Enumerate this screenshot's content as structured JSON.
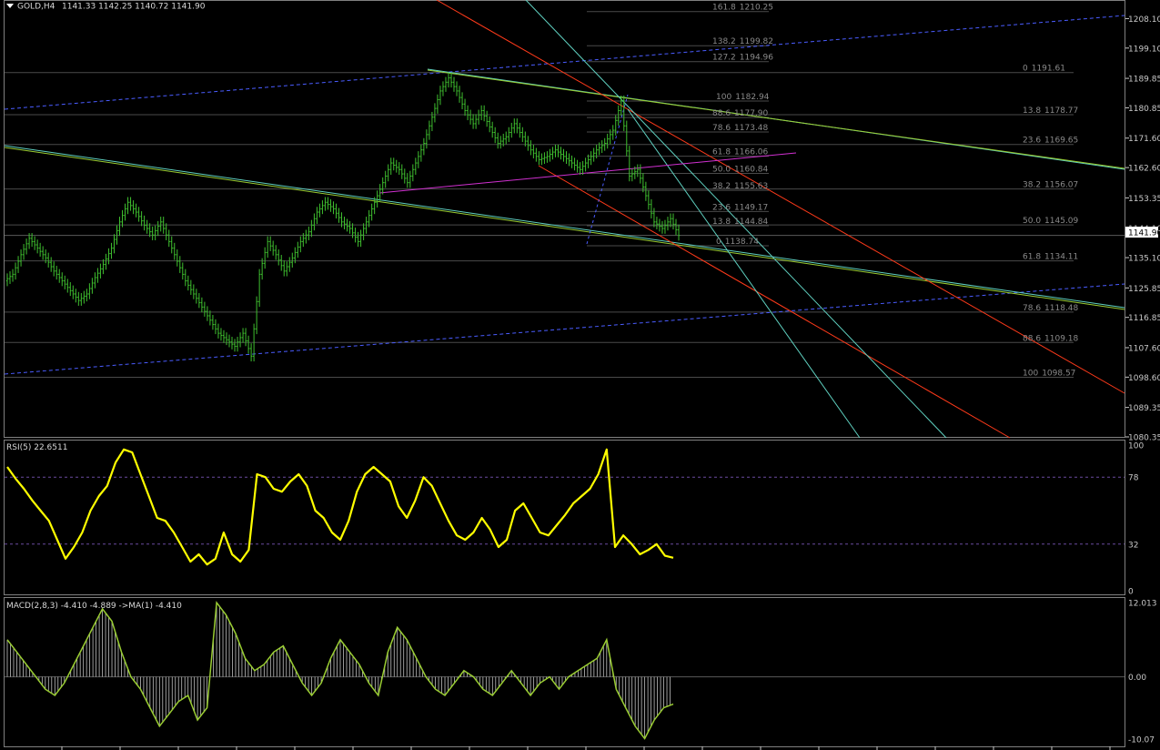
{
  "colors": {
    "background": "#000000",
    "candle": "#3fbf2f",
    "rsi_line": "#ffff00",
    "macd_line": "#9acd32",
    "macd_hist": "#c0c0c0",
    "grid": "#3a3a3a",
    "pane_border": "#808080",
    "price_tag_bg": "#ffffff",
    "fib_line": "#4a4a4a",
    "trend_green": "#9acd32",
    "trend_blue": "#4a5cff",
    "trend_red": "#ff3a1a",
    "trend_cyan": "#5fd0c0",
    "trend_magenta": "#d030d0",
    "rsi_levels": "#6a4aa0"
  },
  "header": {
    "symbol": "GOLD,H4",
    "ohlc": "1141.33 1142.25 1140.72 1141.90",
    "menu_icon": "triangle-down-icon"
  },
  "price_axis": {
    "ticks": [
      "1208.10",
      "1199.10",
      "1189.85",
      "1180.85",
      "1171.60",
      "1162.60",
      "1153.35",
      "1144.10",
      "1135.10",
      "1125.85",
      "1116.85",
      "1107.60",
      "1098.60",
      "1089.35",
      "1080.35"
    ],
    "current_price": "1141.90"
  },
  "fib_labels": {
    "set_a": [
      {
        "level": "161.8",
        "value": "1210.25"
      },
      {
        "level": "138.2",
        "value": "1199.82"
      },
      {
        "level": "127.2",
        "value": "1194.96"
      },
      {
        "level": "100",
        "value": "1182.94"
      },
      {
        "level": "88.6",
        "value": "1177.90"
      },
      {
        "level": "78.6",
        "value": "1173.48"
      },
      {
        "level": "61.8",
        "value": "1166.06"
      },
      {
        "level": "50.0",
        "value": "1160.84"
      },
      {
        "level": "38.2",
        "value": "1155.63"
      },
      {
        "level": "23.6",
        "value": "1149.17"
      },
      {
        "level": "13.8",
        "value": "1144.84"
      },
      {
        "level": "0",
        "value": "1138.74"
      }
    ],
    "set_b": [
      {
        "level": "0",
        "value": "1191.61"
      },
      {
        "level": "13.8",
        "value": "1178.77"
      },
      {
        "level": "23.6",
        "value": "1169.65"
      },
      {
        "level": "38.2",
        "value": "1156.07"
      },
      {
        "level": "50.0",
        "value": "1145.09"
      },
      {
        "level": "61.8",
        "value": "1134.11"
      },
      {
        "level": "78.6",
        "value": "1118.48"
      },
      {
        "level": "88.6",
        "value": "1109.18"
      },
      {
        "level": "100",
        "value": "1098.57"
      }
    ]
  },
  "rsi": {
    "title": "RSI(5) 22.6511",
    "ticks": [
      "100",
      "78",
      "32",
      "0"
    ]
  },
  "macd": {
    "title": "MACD(2,8,3) -4.410 -4.889  ->MA(1) -4.410",
    "ticks": [
      "12.013",
      "0.00",
      "-10.07"
    ]
  },
  "chart_data": {
    "type": "candlestick",
    "title": "GOLD,H4",
    "price_range": [
      1080.35,
      1213.5
    ],
    "close": [
      1130.0,
      1136.0,
      1141.0,
      1138.0,
      1135.0,
      1131.0,
      1128.0,
      1125.0,
      1122.0,
      1124.0,
      1129.0,
      1133.0,
      1138.0,
      1146.0,
      1152.0,
      1149.0,
      1145.0,
      1142.0,
      1146.0,
      1140.0,
      1134.0,
      1128.0,
      1124.0,
      1120.0,
      1116.0,
      1112.0,
      1110.0,
      1108.0,
      1112.0,
      1105.0,
      1130.0,
      1140.0,
      1136.0,
      1131.0,
      1135.0,
      1140.0,
      1143.0,
      1149.0,
      1152.0,
      1150.0,
      1146.0,
      1144.0,
      1140.0,
      1146.0,
      1152.0,
      1158.0,
      1164.0,
      1162.0,
      1158.0,
      1164.0,
      1170.0,
      1178.0,
      1186.0,
      1190.0,
      1186.0,
      1180.0,
      1176.0,
      1180.0,
      1175.0,
      1170.0,
      1172.0,
      1176.0,
      1172.0,
      1168.0,
      1165.0,
      1166.0,
      1168.0,
      1166.0,
      1164.0,
      1162.0,
      1165.0,
      1168.0,
      1170.0,
      1174.0,
      1183.0,
      1160.0,
      1162.0,
      1154.0,
      1146.0,
      1144.0,
      1147.0,
      1141.9
    ],
    "rsi": [
      85.0,
      77.0,
      70.0,
      62.0,
      55.0,
      48.0,
      35.0,
      22.0,
      30.0,
      40.0,
      55.0,
      65.0,
      72.0,
      88.0,
      97.0,
      95.0,
      80.0,
      65.0,
      50.0,
      48.0,
      40.0,
      30.0,
      20.0,
      25.0,
      18.0,
      22.0,
      40.0,
      25.0,
      20.0,
      28.0,
      80.0,
      78.0,
      70.0,
      68.0,
      75.0,
      80.0,
      72.0,
      55.0,
      50.0,
      40.0,
      35.0,
      48.0,
      68.0,
      80.0,
      85.0,
      80.0,
      75.0,
      58.0,
      50.0,
      62.0,
      78.0,
      72.0,
      60.0,
      48.0,
      38.0,
      35.0,
      40.0,
      50.0,
      42.0,
      30.0,
      35.0,
      55.0,
      60.0,
      50.0,
      40.0,
      38.0,
      45.0,
      52.0,
      60.0,
      65.0,
      70.0,
      80.0,
      97.0,
      30.0,
      38.0,
      32.0,
      25.0,
      28.0,
      32.0,
      24.0,
      22.65
    ],
    "macd_line": [
      6.0,
      4.0,
      2.0,
      0.0,
      -2.0,
      -3.0,
      -1.0,
      2.0,
      5.0,
      8.0,
      11.0,
      9.0,
      4.0,
      0.0,
      -2.0,
      -5.0,
      -8.0,
      -6.0,
      -4.0,
      -3.0,
      -7.0,
      -5.0,
      12.0,
      10.0,
      7.0,
      3.0,
      1.0,
      2.0,
      4.0,
      5.0,
      2.0,
      -1.0,
      -3.0,
      -1.0,
      3.0,
      6.0,
      4.0,
      2.0,
      -1.0,
      -3.0,
      4.0,
      8.0,
      6.0,
      3.0,
      0.0,
      -2.0,
      -3.0,
      -1.0,
      1.0,
      0.0,
      -2.0,
      -3.0,
      -1.0,
      1.0,
      -1.0,
      -3.0,
      -1.0,
      0.0,
      -2.0,
      0.0,
      1.0,
      2.0,
      3.0,
      6.0,
      -2.0,
      -5.0,
      -8.0,
      -10.0,
      -7.0,
      -5.0,
      -4.41
    ]
  }
}
